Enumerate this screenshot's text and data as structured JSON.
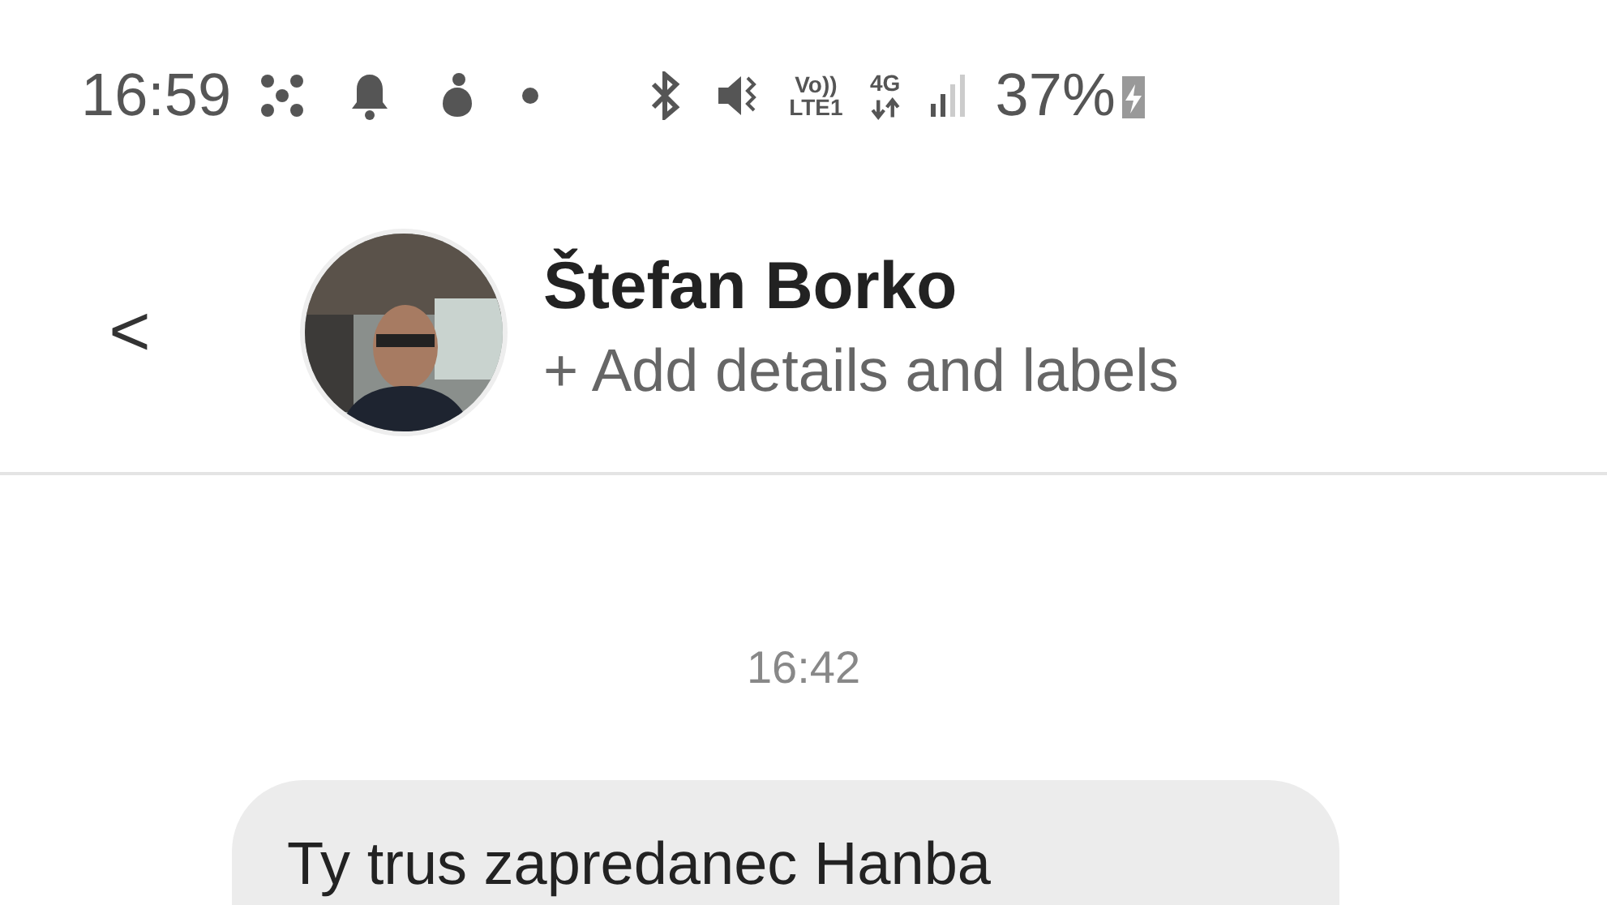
{
  "status_bar": {
    "time": "16:59",
    "volte": "Vo))",
    "lte": "LTE1",
    "network": "4G",
    "battery": "37%"
  },
  "header": {
    "back": "<",
    "contact_name": "Štefan Borko",
    "subtitle": "+ Add details and labels"
  },
  "messages": [
    {
      "kind": "timestamp",
      "text": "16:42"
    },
    {
      "kind": "incoming",
      "text": "Ty trus  zapredanec Hanba"
    }
  ]
}
